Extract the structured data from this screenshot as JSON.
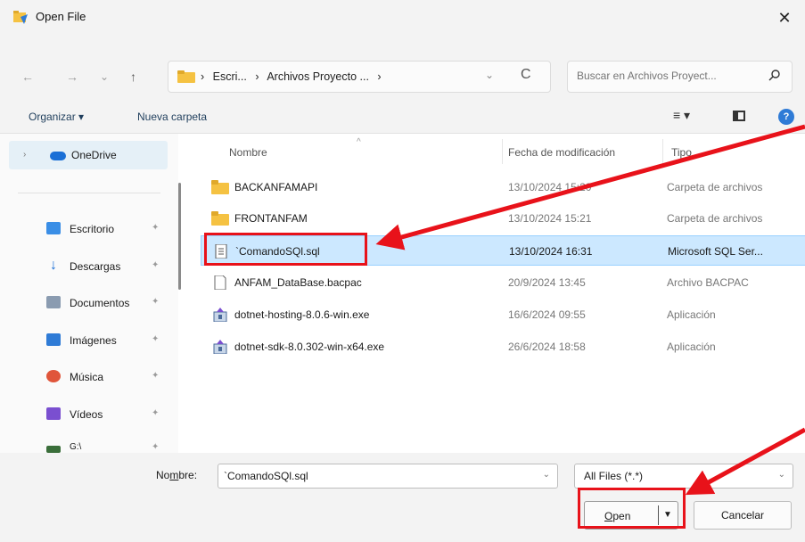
{
  "window": {
    "title": "Open File",
    "close_glyph": "✕"
  },
  "nav": {
    "back_glyph": "←",
    "forward_glyph": "→",
    "recent_glyph": "⌄",
    "up_glyph": "↑",
    "breadcrumb": [
      "Escri...",
      "Archivos Proyecto ..."
    ],
    "sep_glyph": "›",
    "refresh_glyph": "C",
    "search_placeholder": "Buscar en Archivos Proyect..."
  },
  "toolbar": {
    "organize_label": "Organizar ▾",
    "new_folder_label": "Nueva carpeta",
    "view_glyph": "≡ ▾",
    "help_glyph": "?"
  },
  "sidebar": {
    "onedrive_label": "OneDrive",
    "items": [
      {
        "label": "Escritorio",
        "icon": "desktop-icon",
        "color": "#3a8ee6"
      },
      {
        "label": "Descargas",
        "icon": "download-icon",
        "color": "#1a6fd6"
      },
      {
        "label": "Documentos",
        "icon": "documents-icon",
        "color": "#8a9bb0"
      },
      {
        "label": "Imágenes",
        "icon": "pictures-icon",
        "color": "#2f7bd6"
      },
      {
        "label": "Música",
        "icon": "music-icon",
        "color": "#e0553a"
      },
      {
        "label": "Vídeos",
        "icon": "videos-icon",
        "color": "#7a4fd0"
      },
      {
        "label": "G:\\",
        "icon": "drive-icon",
        "color": "#3a6e3a"
      }
    ]
  },
  "columns": {
    "name": "Nombre",
    "date": "Fecha de modificación",
    "type": "Tipo"
  },
  "files": [
    {
      "name": "BACKANFAMAPI",
      "date": "13/10/2024 15:20",
      "type": "Carpeta de archivos",
      "kind": "folder"
    },
    {
      "name": "FRONTANFAM",
      "date": "13/10/2024 15:21",
      "type": "Carpeta de archivos",
      "kind": "folder"
    },
    {
      "name": "`ComandoSQl.sql",
      "date": "13/10/2024 16:31",
      "type": "Microsoft SQL Ser...",
      "kind": "sql",
      "selected": true
    },
    {
      "name": "ANFAM_DataBase.bacpac",
      "date": "20/9/2024 13:45",
      "type": "Archivo BACPAC",
      "kind": "file"
    },
    {
      "name": "dotnet-hosting-8.0.6-win.exe",
      "date": "16/6/2024 09:55",
      "type": "Aplicación",
      "kind": "exe"
    },
    {
      "name": "dotnet-sdk-8.0.302-win-x64.exe",
      "date": "26/6/2024 18:58",
      "type": "Aplicación",
      "kind": "exe"
    }
  ],
  "footer": {
    "name_label_pre": "No",
    "name_label_u": "m",
    "name_label_post": "bre:",
    "filename_value": "`ComandoSQl.sql",
    "filetype_value": "All Files (*.*)",
    "open_label_u": "O",
    "open_label_rest": "pen",
    "cancel_label": "Cancelar"
  },
  "colors": {
    "annotation": "#e8121a",
    "selection": "#cce8ff",
    "folder": "#f5c242"
  }
}
